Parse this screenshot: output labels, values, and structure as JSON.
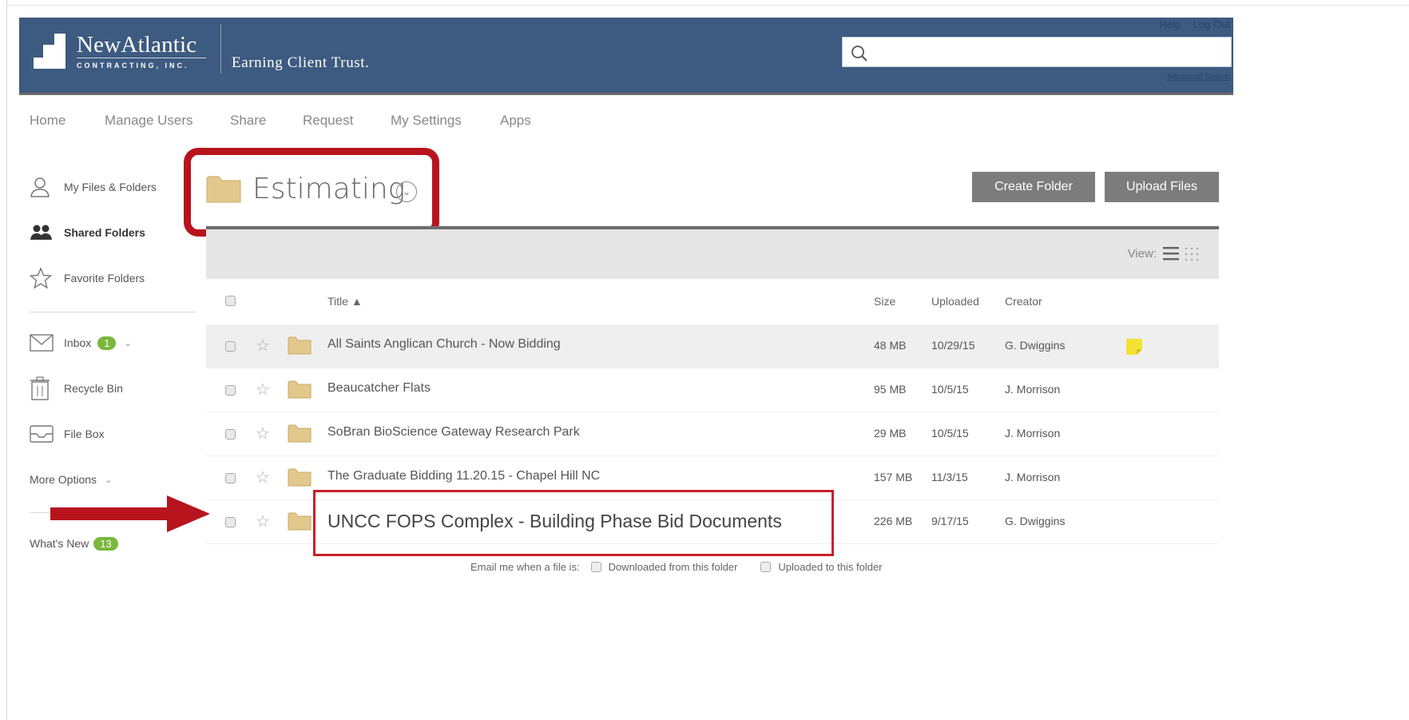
{
  "header": {
    "logo_name": "NewAtlantic",
    "logo_sub": "CONTRACTING, INC.",
    "tagline": "Earning Client Trust.",
    "help_label": "Help",
    "logout_label": "Log Out",
    "advanced_search_label": "Advanced Search",
    "search_placeholder": "",
    "brand_color": "#3d5a80"
  },
  "nav": {
    "items": [
      "Home",
      "Manage Users",
      "Share",
      "Request",
      "My Settings",
      "Apps"
    ]
  },
  "sidebar": {
    "my_files": "My Files & Folders",
    "shared_folders": "Shared Folders",
    "favorite_folders": "Favorite Folders",
    "inbox": "Inbox",
    "inbox_count": "1",
    "recycle_bin": "Recycle Bin",
    "file_box": "File Box",
    "more_options": "More Options",
    "whats_new": "What's New",
    "whats_new_count": "13"
  },
  "folder": {
    "title": "Estimating",
    "create_folder_label": "Create Folder",
    "upload_files_label": "Upload Files",
    "view_label": "View:"
  },
  "table": {
    "headers": {
      "title": "Title ▲",
      "size": "Size",
      "uploaded": "Uploaded",
      "creator": "Creator"
    },
    "rows": [
      {
        "title": "All Saints Anglican Church - Now Bidding",
        "size": "48 MB",
        "uploaded": "10/29/15",
        "creator": "G. Dwiggins",
        "note": true
      },
      {
        "title": "Beaucatcher Flats",
        "size": "95 MB",
        "uploaded": "10/5/15",
        "creator": "J. Morrison",
        "note": false
      },
      {
        "title": "SoBran BioScience Gateway Research Park",
        "size": "29 MB",
        "uploaded": "10/5/15",
        "creator": "J. Morrison",
        "note": false
      },
      {
        "title": "The Graduate Bidding 11.20.15 - Chapel Hill NC",
        "size": "157 MB",
        "uploaded": "11/3/15",
        "creator": "J. Morrison",
        "note": false
      },
      {
        "title": "UNCC FOPS Complex - Building Phase Bid Documents",
        "size": "226 MB",
        "uploaded": "9/17/15",
        "creator": "G. Dwiggins",
        "note": false
      }
    ]
  },
  "footer": {
    "email_label": "Email me when a file is:",
    "downloaded_label": "Downloaded from this folder",
    "uploaded_label": "Uploaded to this folder"
  },
  "colors": {
    "annotation_red": "#c8202a",
    "button_gray": "#7c7c7c",
    "badge_green": "#7ab73c",
    "folder_tan": "#e2c88d"
  }
}
